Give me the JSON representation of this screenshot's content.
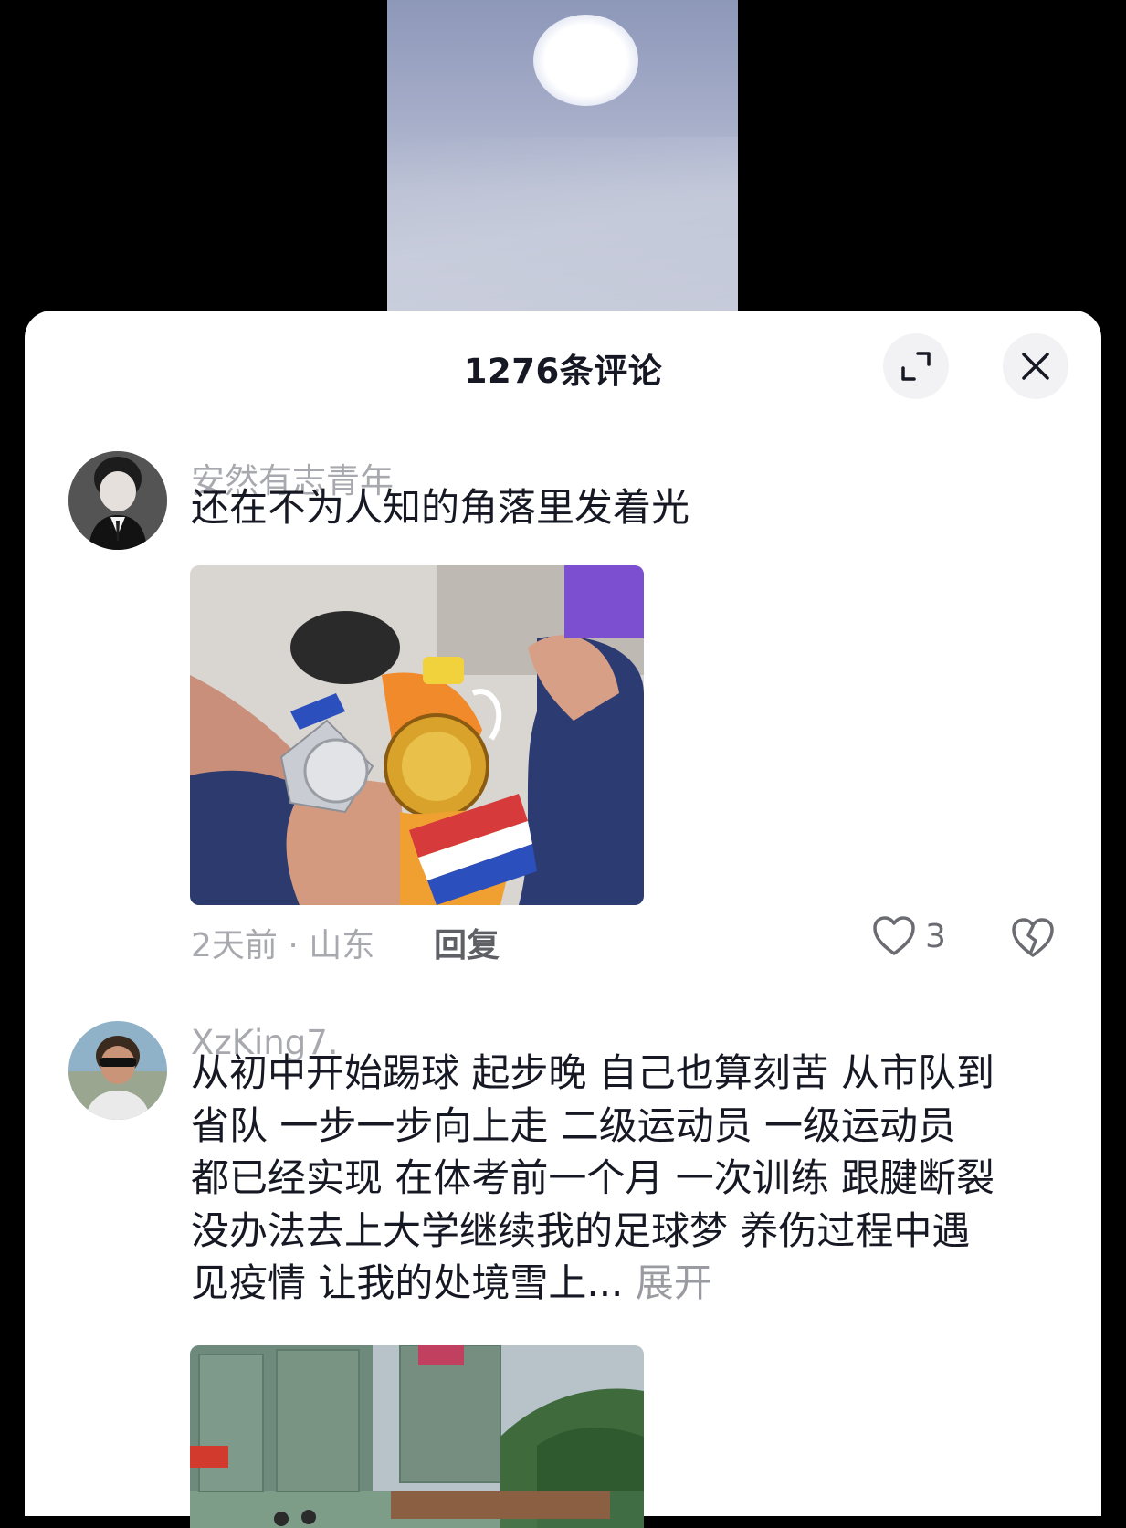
{
  "sheet": {
    "title": "1276条评论"
  },
  "comments": [
    {
      "username": "安然有志青年",
      "text": "还在不为人知的角落里发着光",
      "time_location": "2天前 · 山东",
      "reply_label": "回复",
      "like_count": "3"
    },
    {
      "username": "XzKing7.",
      "lines": [
        "从初中开始踢球 起步晚 自己也算刻苦 从市队到",
        "省队 一步一步向上走 二级运动员 一级运动员",
        "都已经实现 在体考前一个月 一次训练 跟腱断裂",
        "没办法去上大学继续我的足球梦 养伤过程中遇"
      ],
      "last_line": "见疫情 让我的处境雪上...",
      "more_label": "展开"
    }
  ],
  "icons": {
    "expand": "expand-icon",
    "close": "close-icon",
    "like": "heart-icon",
    "dislike": "broken-heart-icon"
  },
  "colors": {
    "text_primary": "#161823",
    "text_secondary": "#a8a9ae",
    "sheet_bg": "#ffffff",
    "backdrop": "#000000"
  }
}
